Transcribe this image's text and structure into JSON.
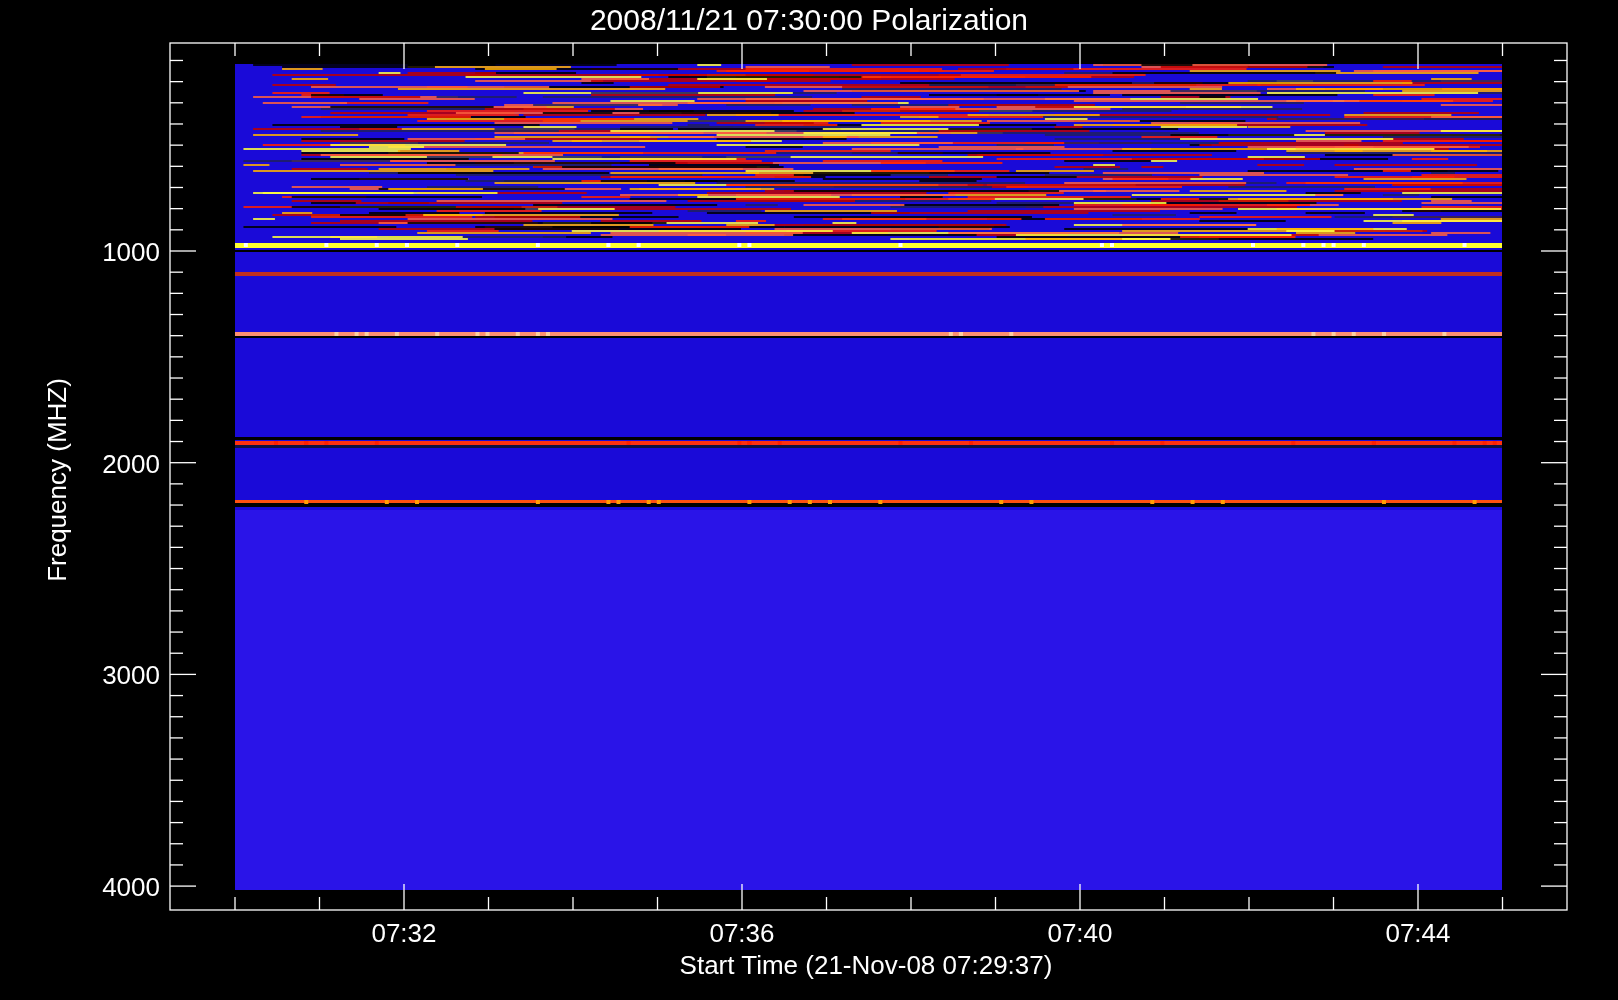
{
  "plot": {
    "title": "2008/11/21 07:30:00 Polarization",
    "ylabel": "Frequency (MHZ)",
    "xlabel": "Start Time (21-Nov-08 07:29:37)",
    "yticks": [
      "1000",
      "2000",
      "3000",
      "4000"
    ],
    "xticks": [
      "07:32",
      "07:36",
      "07:40",
      "07:44"
    ]
  }
}
